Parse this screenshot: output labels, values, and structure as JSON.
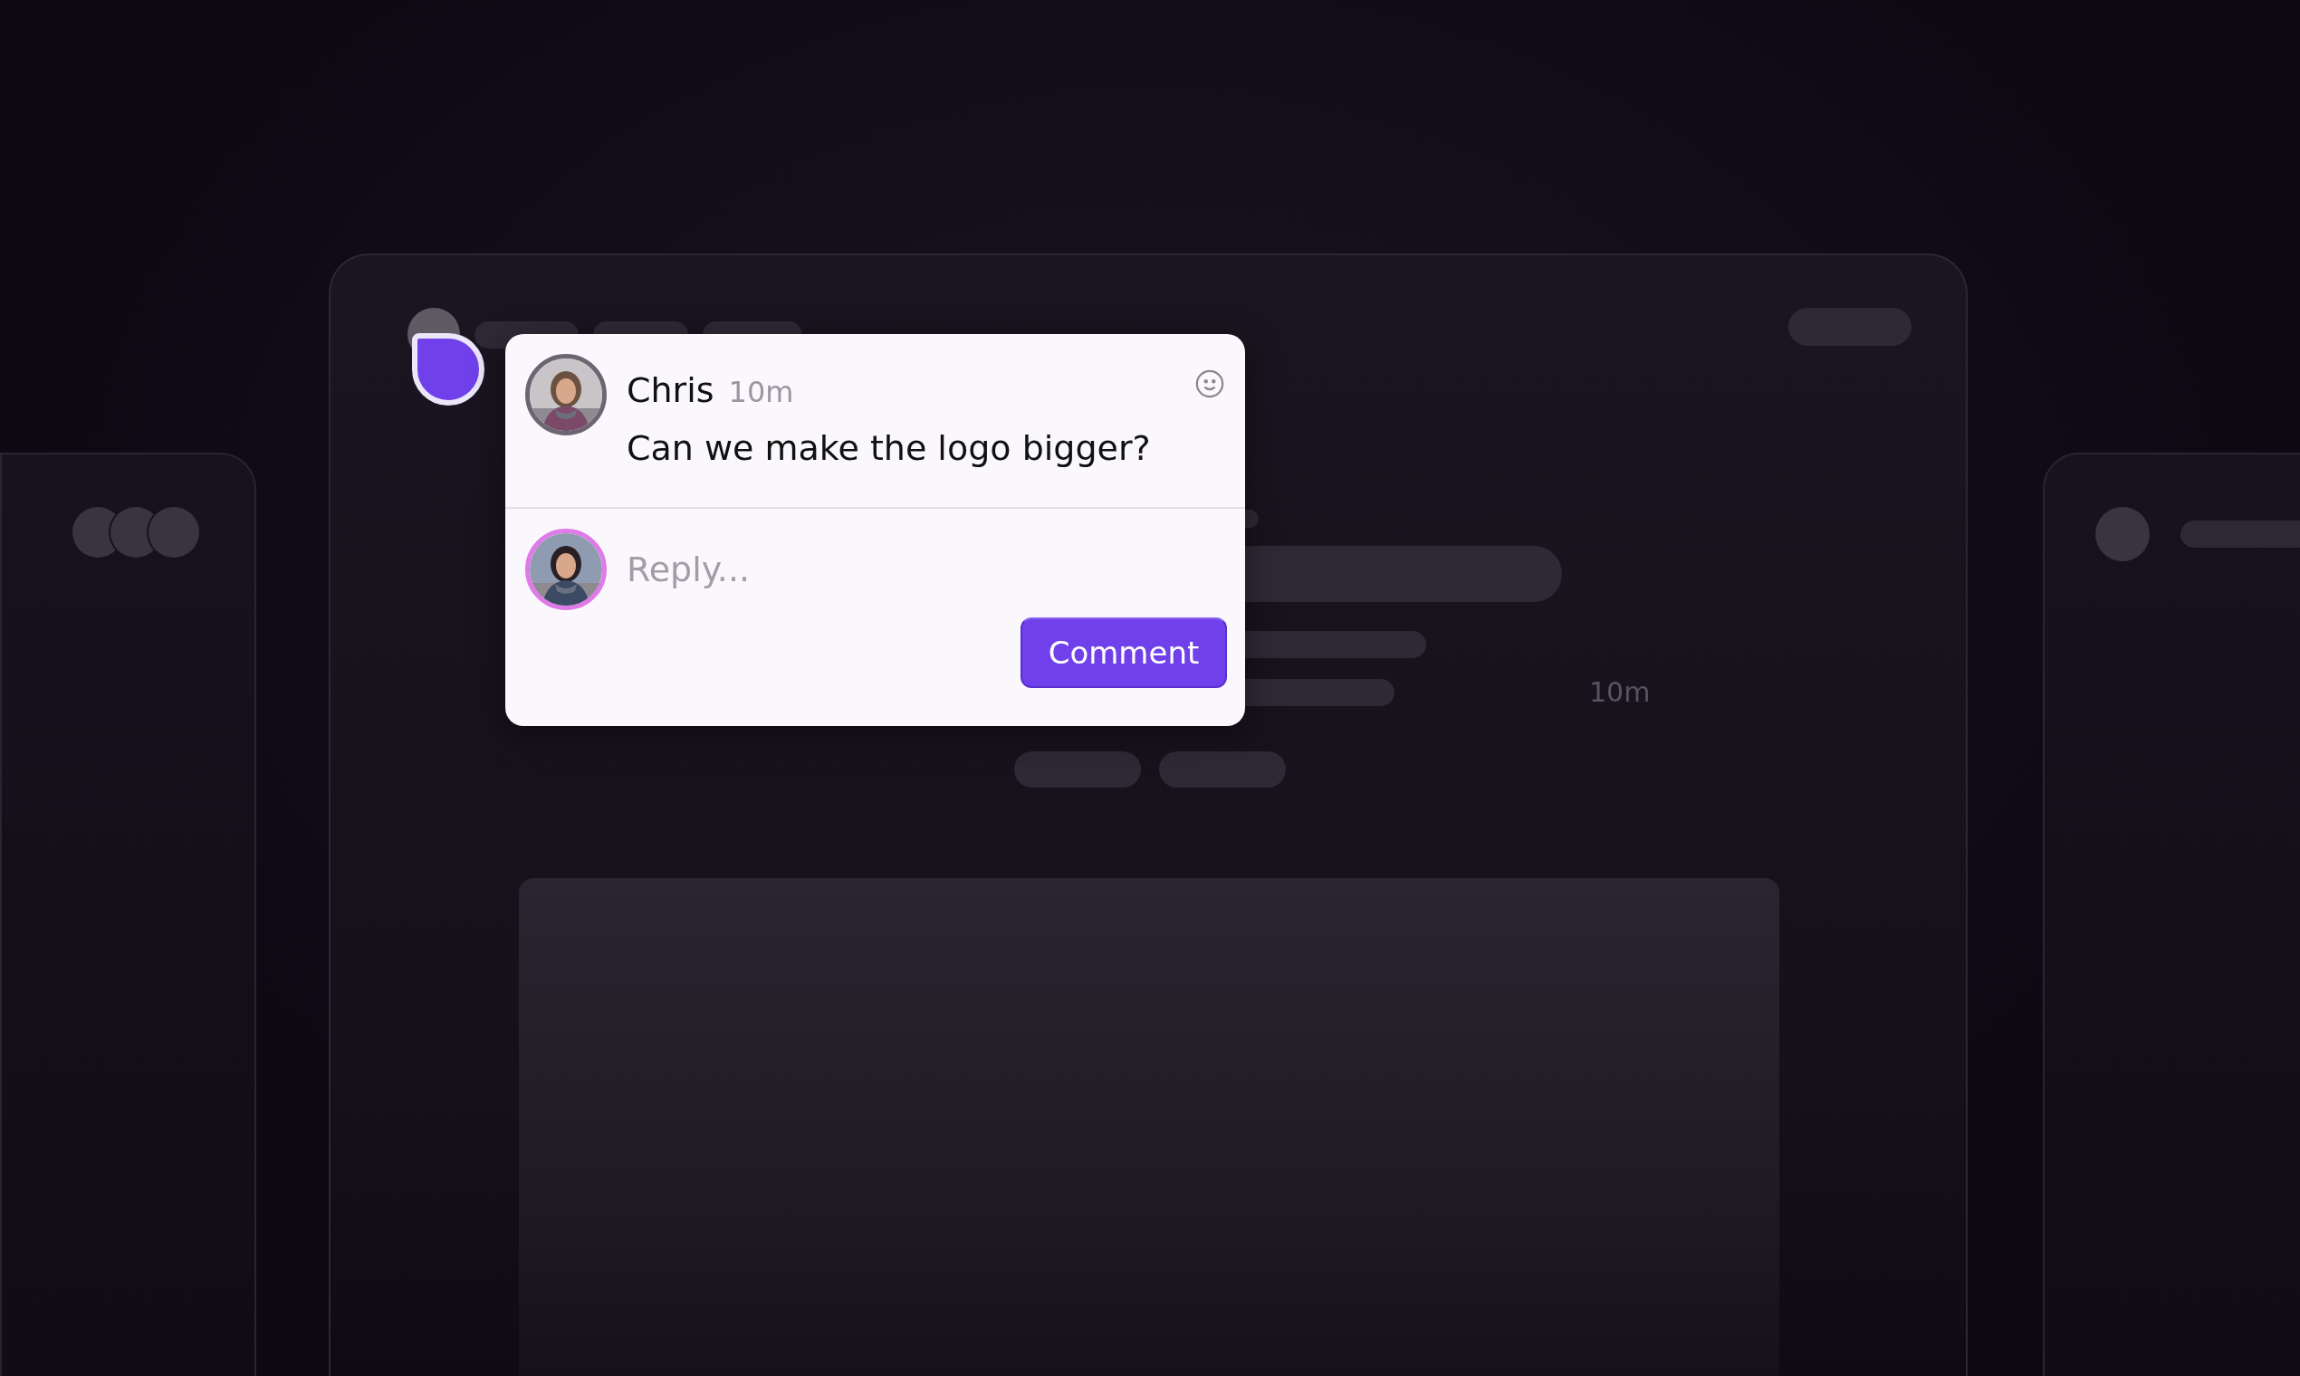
{
  "comment": {
    "author": "Chris",
    "time": "10m",
    "message": "Can we make the logo bigger?"
  },
  "reply": {
    "placeholder": "Reply..."
  },
  "button": {
    "label": "Comment"
  },
  "background_text": "10m"
}
